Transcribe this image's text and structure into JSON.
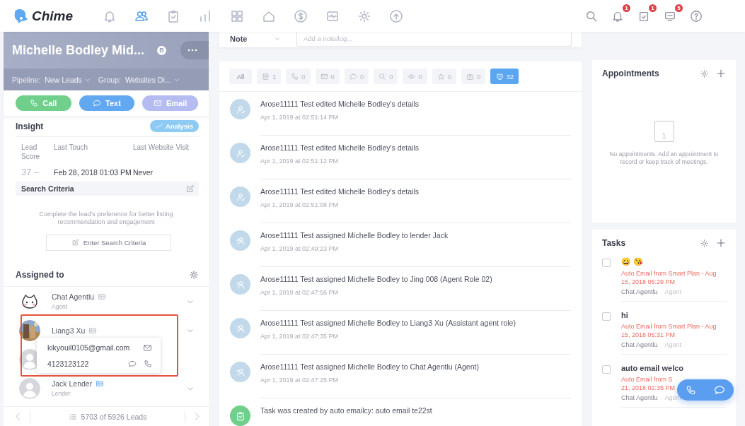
{
  "app": {
    "name": "Chime"
  },
  "nav": [
    {
      "selected": false
    },
    {
      "selected": true
    },
    {
      "selected": false
    },
    {
      "selected": false
    },
    {
      "selected": false
    },
    {
      "selected": false
    },
    {
      "selected": false
    },
    {
      "selected": false
    },
    {
      "selected": false
    },
    {
      "selected": false
    }
  ],
  "notifications": {
    "alerts": "1",
    "tasks": "1",
    "messages": "5"
  },
  "lead": {
    "name": "Michelle Bodley Mid...",
    "grade": "B",
    "pipeline_label": "Pipeline:",
    "pipeline": "New Leads",
    "group_label": "Group:",
    "group": "Websites Di..."
  },
  "actions": [
    {
      "label": "Call",
      "kind": "call"
    },
    {
      "label": "Text",
      "kind": "text"
    },
    {
      "label": "Email",
      "kind": "email"
    }
  ],
  "insight": {
    "title": "Insight",
    "analysis": "Analysis",
    "columns": [
      {
        "label": "Lead Score",
        "value": "37 –"
      },
      {
        "label": "Last Touch",
        "value": "Feb 28, 2018 01:03 PM"
      },
      {
        "label": "Last Website Visit",
        "value": "Never"
      }
    ]
  },
  "search_criteria": {
    "title": "Search Criteria",
    "hint": "Complete the lead's preference for better listing recommendation and engagement",
    "button": "Enter Search Criteria"
  },
  "assigned": {
    "title": "Assigned to",
    "people": [
      {
        "name": "Chat Agentlu",
        "role": "Agent",
        "kind": "mascot"
      },
      {
        "name": "Liang3 Xu"
      },
      {
        "kind": "blank"
      },
      {
        "name": "Jack Lender",
        "role": "Lender",
        "kind": "blank"
      }
    ]
  },
  "contact_popover": {
    "email": "kikyouil0105@gmail.com",
    "phone": "4123123122"
  },
  "pager": {
    "text": "5703 of 5926 Leads"
  },
  "note": {
    "type": "Note",
    "placeholder": "Add a note/log..."
  },
  "filters": [
    {
      "label": "All",
      "selected": false
    },
    {
      "label": "1",
      "selected": false
    },
    {
      "label": "0",
      "selected": false
    },
    {
      "label": "0",
      "selected": false
    },
    {
      "label": "0",
      "selected": false
    },
    {
      "label": "0",
      "selected": false
    },
    {
      "label": "0",
      "selected": false
    },
    {
      "label": "0",
      "selected": false
    },
    {
      "label": "0",
      "selected": false
    },
    {
      "label": "32",
      "selected": true
    }
  ],
  "activities": [
    {
      "kind": "edit",
      "text": "Arose11111 Test edited Michelle Bodley's details",
      "time": "Apr 1, 2019 at 02:51:14 PM"
    },
    {
      "kind": "edit",
      "text": "Arose11111 Test edited Michelle Bodley's details",
      "time": "Apr 1, 2019 at 02:51:12 PM"
    },
    {
      "kind": "edit",
      "text": "Arose11111 Test edited Michelle Bodley's details",
      "time": "Apr 1, 2019 at 02:51:08 PM"
    },
    {
      "kind": "assign",
      "text": "Arose11111 Test assigned Michelle Bodley to lender Jack",
      "time": "Apr 1, 2019 at 02:49:23 PM"
    },
    {
      "kind": "assign",
      "text": "Arose11111 Test assigned Michelle Bodley to Jing 008 (Agent Role 02)",
      "time": "Apr 1, 2019 at 02:47:56 PM"
    },
    {
      "kind": "assign",
      "text": "Arose11111 Test assigned Michelle Bodley to Liang3 Xu (Assistant agent role)",
      "time": "Apr 1, 2019 at 02:47:35 PM"
    },
    {
      "kind": "assign",
      "text": "Arose11111 Test assigned Michelle Bodley to Chat Agentlu (Agent)",
      "time": "Apr 1, 2019 at 02:47:25 PM"
    },
    {
      "kind": "task",
      "text": "Task was created by auto emailcy: auto email te22st"
    }
  ],
  "appointments": {
    "title": "Appointments",
    "calendar_day": "1",
    "empty": "No appointments. Add an appointment to record or keep track of meetings."
  },
  "tasks": {
    "title": "Tasks",
    "items": [
      {
        "title": "😀 😘",
        "checked": false,
        "due_lines": [
          "Auto Email from Smart Plan - Aug",
          "15, 2018 05:29 PM"
        ],
        "owner": "Chat Agentlu",
        "role": "Agent"
      },
      {
        "title": "hi",
        "checked": false,
        "due_lines": [
          "Auto Email from Smart Plan - Aug",
          "15, 2018 05:31 PM"
        ],
        "owner": "Chat Agentlu",
        "role": "Agent"
      },
      {
        "title": "auto email welco",
        "checked": false,
        "due_lines": [
          "Auto Email from S",
          "21, 2018 02:35 PM"
        ],
        "owner": "Chat Agentlu",
        "role": "Agent"
      }
    ]
  }
}
